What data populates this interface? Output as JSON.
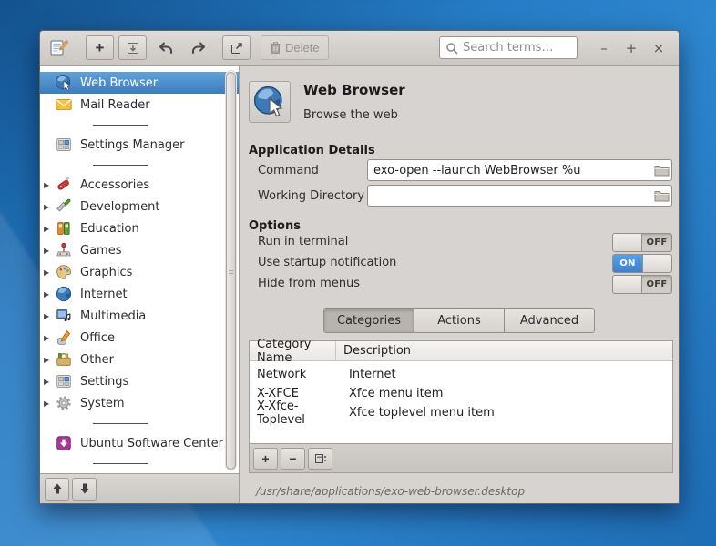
{
  "window": {
    "search_placeholder": "Search terms…",
    "minimize_glyph": "–",
    "maximize_glyph": "+",
    "close_glyph": "×"
  },
  "toolbar": {
    "delete_label": "Delete"
  },
  "sidebar": {
    "items": [
      {
        "label": "Web Browser"
      },
      {
        "label": "Mail Reader"
      },
      {
        "label": "Settings Manager"
      },
      {
        "label": "Accessories"
      },
      {
        "label": "Development"
      },
      {
        "label": "Education"
      },
      {
        "label": "Games"
      },
      {
        "label": "Graphics"
      },
      {
        "label": "Internet"
      },
      {
        "label": "Multimedia"
      },
      {
        "label": "Office"
      },
      {
        "label": "Other"
      },
      {
        "label": "Settings"
      },
      {
        "label": "System"
      },
      {
        "label": "Ubuntu Software Center"
      }
    ]
  },
  "header": {
    "title": "Web Browser",
    "subtitle": "Browse the web"
  },
  "details": {
    "section_title": "Application Details",
    "command_label": "Command",
    "command_value": "exo-open --launch WebBrowser %u",
    "working_directory_label": "Working Directory",
    "working_directory_value": ""
  },
  "options": {
    "section_title": "Options",
    "toggles": [
      {
        "label": "Run in terminal",
        "state": "OFF"
      },
      {
        "label": "Use startup notification",
        "state": "ON"
      },
      {
        "label": "Hide from menus",
        "state": "OFF"
      }
    ]
  },
  "tabs": [
    {
      "label": "Categories"
    },
    {
      "label": "Actions"
    },
    {
      "label": "Advanced"
    }
  ],
  "categories_table": {
    "columns": [
      "Category Name",
      "Description"
    ],
    "rows": [
      {
        "category": "Network",
        "description": "Internet"
      },
      {
        "category": "X-XFCE",
        "description": "Xfce menu item"
      },
      {
        "category": "X-Xfce-Toplevel",
        "description": "Xfce toplevel menu item"
      }
    ]
  },
  "statusbar": {
    "path": "/usr/share/applications/exo-web-browser.desktop"
  },
  "colors": {
    "selection_blue": "#4a8fd0",
    "toggle_on_blue": "#4795e0",
    "desktop_blue": "#2277c0",
    "window_gray": "#d6d3d0"
  }
}
